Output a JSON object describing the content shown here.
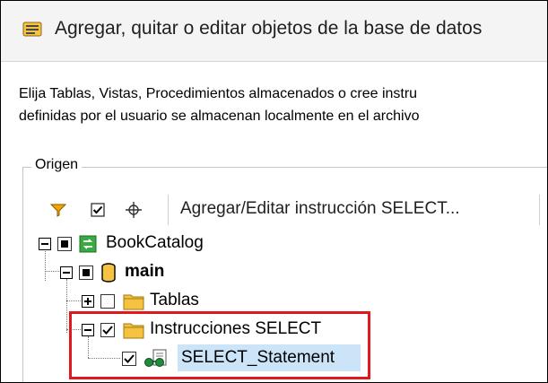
{
  "window": {
    "title": "Agregar, quitar o editar objetos de la base de datos",
    "title_icon": "database-objects-icon"
  },
  "description": {
    "line1": "Elija Tablas, Vistas, Procedimientos almacenados o cree instru",
    "line2": "definidas por el usuario se almacenan localmente en el archivo"
  },
  "source_group": {
    "label": "Origen"
  },
  "toolbar": {
    "filter_icon": "filter-icon",
    "check_icon": "check-objects-icon",
    "locate_icon": "locate-icon",
    "add_select_label": "Agregar/Editar instrucción SELECT..."
  },
  "tree": {
    "root": {
      "label": "BookCatalog",
      "icon": "database-connection-icon",
      "expanded": true,
      "checked": "partial"
    },
    "schema": {
      "label": "main",
      "icon": "database-schema-icon",
      "expanded": true,
      "checked": "partial"
    },
    "tables": {
      "label": "Tablas",
      "icon": "folder-icon",
      "expanded": false,
      "checked": false
    },
    "select_folder": {
      "label": "Instrucciones SELECT",
      "icon": "folder-icon",
      "expanded": true,
      "checked": true
    },
    "select_item": {
      "label": "SELECT_Statement",
      "icon": "select-statement-icon",
      "checked": true,
      "selected": true
    }
  },
  "colors": {
    "highlight_border": "#e0191f",
    "selection_bg": "#cce4f7",
    "folder": "#f5c242",
    "db_green": "#3aa845"
  }
}
